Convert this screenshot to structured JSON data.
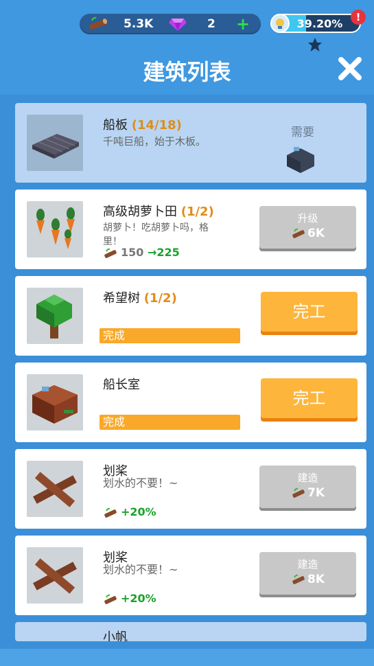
{
  "header": {
    "wood_amount": "5.3K",
    "gem_amount": "2",
    "plus_symbol": "+",
    "progress_text": "39.20%",
    "progress_fraction": 0.392,
    "alert_symbol": "!",
    "title": "建筑列表",
    "colors": {
      "accent": "#3f98e0",
      "gem": "#c13cf0",
      "plus": "#2ee04a",
      "alert": "#e8323c"
    }
  },
  "buildings": [
    {
      "name": "船板",
      "count": "(14/18)",
      "desc": "千吨巨船，始于木板。",
      "need_label": "需要",
      "icon": "wooden-plank-icon",
      "need_icon": "cabin-building-icon"
    },
    {
      "name": "高级胡萝卜田",
      "count": "(1/2)",
      "desc": "胡萝卜！吃胡萝卜吗，格里！",
      "stat_from": "150",
      "stat_arrow": "→",
      "stat_to": "225",
      "button_label": "升级",
      "button_cost": "6K",
      "icon": "carrot-icon"
    },
    {
      "name": "希望树",
      "count": "(1/2)",
      "status": "完成",
      "button_label": "完工",
      "icon": "tree-icon"
    },
    {
      "name": "船长室",
      "status": "完成",
      "button_label": "完工",
      "icon": "cabin-building-icon"
    },
    {
      "name": "划桨",
      "desc": "划水的不要！~",
      "stat_bonus": "+20%",
      "button_label": "建造",
      "button_cost": "7K",
      "icon": "oars-icon"
    },
    {
      "name": "划桨",
      "desc": "划水的不要！~",
      "stat_bonus": "+20%",
      "button_label": "建造",
      "button_cost": "8K",
      "icon": "oars-icon"
    },
    {
      "name": "小帆",
      "icon": "sail-icon"
    }
  ]
}
